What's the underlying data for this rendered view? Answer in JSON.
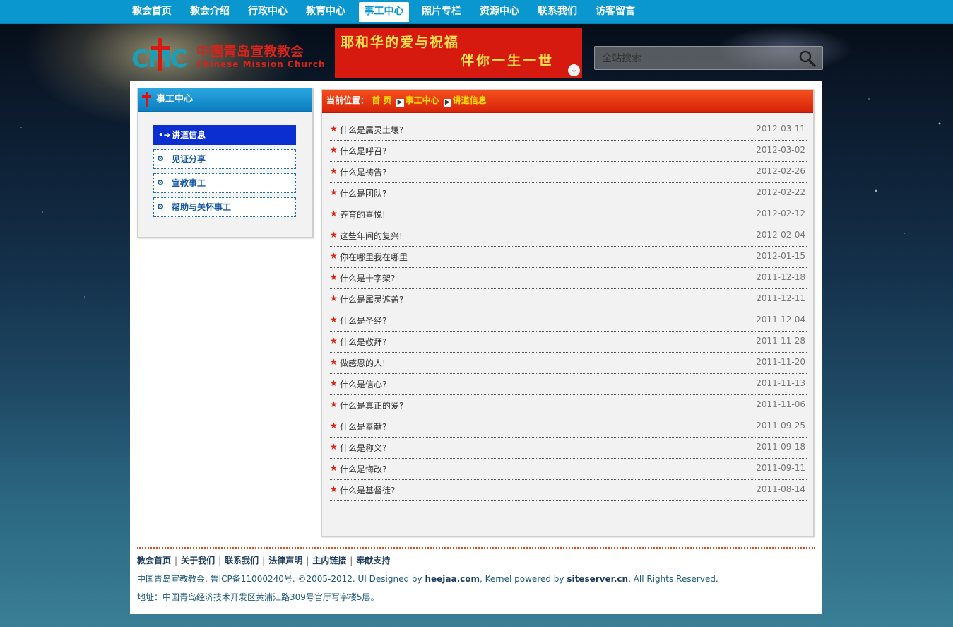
{
  "topnav": {
    "items": [
      {
        "label": "教会首页"
      },
      {
        "label": "教会介绍"
      },
      {
        "label": "行政中心"
      },
      {
        "label": "教育中心"
      },
      {
        "label": "事工中心",
        "active": true
      },
      {
        "label": "照片专栏"
      },
      {
        "label": "资源中心"
      },
      {
        "label": "联系我们"
      },
      {
        "label": "访客留言"
      }
    ]
  },
  "header": {
    "logo_mark": "CMC",
    "logo_cn": "中国青岛宣教教会",
    "logo_en": "Chinese Mission Church",
    "banner_line1": "耶和华的爱与祝福",
    "banner_line2": "伴你一生一世",
    "search_placeholder": "全站搜索"
  },
  "sidebar": {
    "title": "事工中心",
    "items": [
      {
        "label": "讲道信息",
        "active": true
      },
      {
        "label": "见证分享"
      },
      {
        "label": "宣教事工"
      },
      {
        "label": "帮助与关怀事工"
      }
    ]
  },
  "breadcrumb": {
    "prefix": "当前位置：",
    "items": [
      "首 页",
      "事工中心",
      "讲道信息"
    ]
  },
  "articles": [
    {
      "title": "什么是属灵土壤?",
      "date": "2012-03-11"
    },
    {
      "title": "什么是呼召?",
      "date": "2012-03-02"
    },
    {
      "title": "什么是祷告?",
      "date": "2012-02-26"
    },
    {
      "title": "什么是团队?",
      "date": "2012-02-22"
    },
    {
      "title": "养育的喜悦!",
      "date": "2012-02-12"
    },
    {
      "title": "这些年间的复兴!",
      "date": "2012-02-04"
    },
    {
      "title": "你在哪里我在哪里",
      "date": "2012-01-15"
    },
    {
      "title": "什么是十字架?",
      "date": "2011-12-18"
    },
    {
      "title": "什么是属灵遮盖?",
      "date": "2011-12-11"
    },
    {
      "title": "什么是圣经?",
      "date": "2011-12-04"
    },
    {
      "title": "什么是敬拜?",
      "date": "2011-11-28"
    },
    {
      "title": "做感恩的人!",
      "date": "2011-11-20"
    },
    {
      "title": "什么是信心?",
      "date": "2011-11-13"
    },
    {
      "title": "什么是真正的爱?",
      "date": "2011-11-06"
    },
    {
      "title": "什么是奉献?",
      "date": "2011-09-25"
    },
    {
      "title": "什么是称义?",
      "date": "2011-09-18"
    },
    {
      "title": "什么是悔改?",
      "date": "2011-09-11"
    },
    {
      "title": "什么是基督徒?",
      "date": "2011-08-14"
    }
  ],
  "footer": {
    "links": [
      "教会首页",
      "关于我们",
      "联系我们",
      "法律声明",
      "主内链接",
      "奉献支持"
    ],
    "separator": "|",
    "copyright_pre": "中国青岛宣教教会. 鲁ICP备11000240号. ©2005-2012. UI Designed by ",
    "designer": "heejaa.com",
    "copyright_mid": ", Kernel powered by ",
    "kernel": "siteserver.cn",
    "copyright_post": ". All Rights Reserved.",
    "address": "地址：中国青岛经济技术开发区黄浦江路309号官厅写字楼5层。"
  },
  "colors": {
    "nav_bg": "#0a96cf",
    "crumb_bg": "#e8360f",
    "side_active": "#0a2ecf",
    "star": "#e2200e",
    "crumb_link": "#ffe600"
  },
  "icons": {
    "search": "magnifier-icon",
    "banner_toggle": "chevron-down-icon",
    "list_bullet": "star-icon",
    "crumb_separator": "arrow-right-icon"
  }
}
